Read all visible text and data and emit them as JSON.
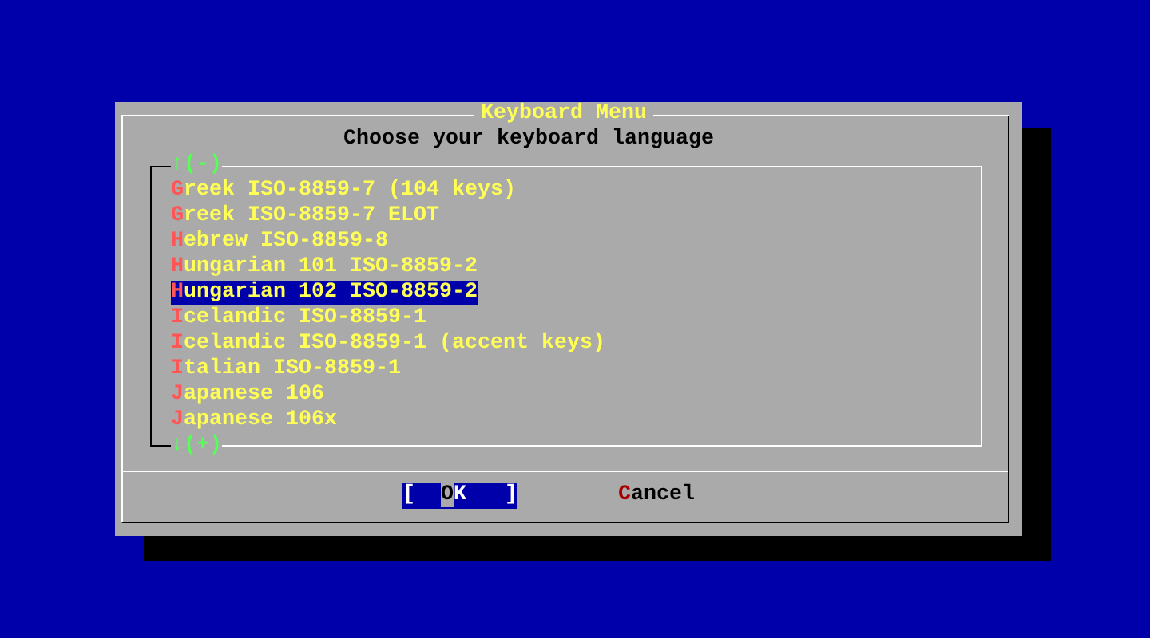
{
  "dialog": {
    "title": "Keyboard Menu",
    "prompt": "Choose your keyboard language",
    "scroll_up": "↑(-)",
    "scroll_down": "↓(+)",
    "items": [
      {
        "label": "Greek ISO-8859-7 (104 keys)",
        "selected": false
      },
      {
        "label": "Greek ISO-8859-7 ELOT",
        "selected": false
      },
      {
        "label": "Hebrew ISO-8859-8",
        "selected": false
      },
      {
        "label": "Hungarian 101 ISO-8859-2",
        "selected": false
      },
      {
        "label": "Hungarian 102 ISO-8859-2",
        "selected": true
      },
      {
        "label": "Icelandic ISO-8859-1",
        "selected": false
      },
      {
        "label": "Icelandic ISO-8859-1 (accent keys)",
        "selected": false
      },
      {
        "label": "Italian ISO-8859-1",
        "selected": false
      },
      {
        "label": "Japanese 106",
        "selected": false
      },
      {
        "label": "Japanese 106x",
        "selected": false
      }
    ],
    "buttons": [
      {
        "label": "[  OK   ]",
        "selected": true
      },
      {
        "label": "Cancel",
        "selected": false
      }
    ]
  }
}
